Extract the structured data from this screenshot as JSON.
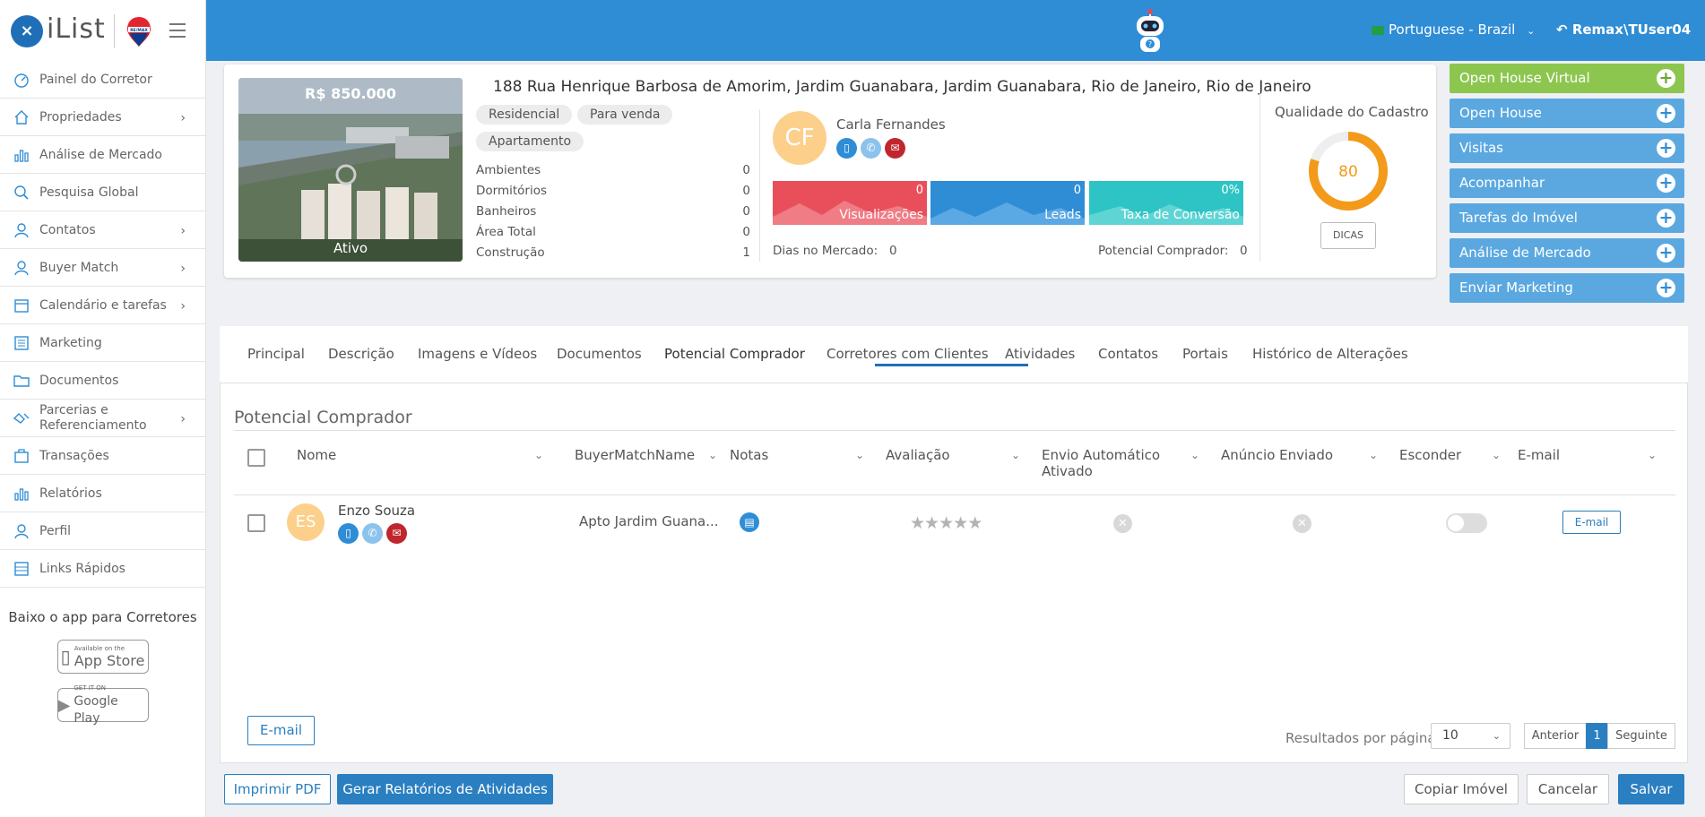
{
  "header": {
    "logo_text": "iList",
    "logo_mark": "×",
    "brand_badge": "RE/MAX",
    "language": "Portuguese - Brazil",
    "user": "Remax\\TUser04"
  },
  "sidebar": {
    "items": [
      {
        "label": "Painel do Corretor",
        "icon": "dashboard-icon"
      },
      {
        "label": "Propriedades",
        "icon": "house-icon"
      },
      {
        "label": "Análise de Mercado",
        "icon": "bar-chart-icon"
      },
      {
        "label": "Pesquisa Global",
        "icon": "search-icon"
      },
      {
        "label": "Contatos",
        "icon": "contacts-icon"
      },
      {
        "label": "Buyer Match",
        "icon": "buyer-match-icon"
      },
      {
        "label": "Calendário e tarefas",
        "icon": "calendar-icon"
      },
      {
        "label": "Marketing",
        "icon": "marketing-icon"
      },
      {
        "label": "Documentos",
        "icon": "folder-icon"
      },
      {
        "label": "Parcerias e Referenciamento",
        "icon": "handshake-icon"
      },
      {
        "label": "Transações",
        "icon": "transactions-icon"
      },
      {
        "label": "Relatórios",
        "icon": "reports-icon"
      },
      {
        "label": "Perfil",
        "icon": "user-icon"
      },
      {
        "label": "Links Rápidos",
        "icon": "quick-links-icon"
      }
    ],
    "app_title": "Baixo o app para Corretores",
    "app_store_small": "Available on the",
    "app_store": "App Store",
    "google_play_small": "GET IT ON",
    "google_play": "Google Play"
  },
  "property": {
    "price": "R$ 850.000",
    "status": "Ativo",
    "address": "188 Rua Henrique Barbosa de Amorim, Jardim Guanabara, Jardim Guanabara, Rio de Janeiro, Rio de Janeiro",
    "tags": [
      "Residencial",
      "Para venda",
      "Apartamento"
    ],
    "specs": [
      {
        "label": "Ambientes",
        "value": "0"
      },
      {
        "label": "Dormitórios",
        "value": "0"
      },
      {
        "label": "Banheiros",
        "value": "0"
      },
      {
        "label": "Área Total",
        "value": "0"
      },
      {
        "label": "Construção",
        "value": "1"
      }
    ],
    "agent_initials": "CF",
    "agent_name": "Carla Fernandes",
    "metrics": [
      {
        "value": "0",
        "label": "Visualizações",
        "color": "#e94f5b"
      },
      {
        "value": "0",
        "label": "Leads",
        "color": "#2f8dd6"
      },
      {
        "value": "0%",
        "label": "Taxa de Conversão",
        "color": "#2ec3c4"
      }
    ],
    "days_label": "Dias no Mercado:",
    "days_value": "0",
    "potential_label": "Potencial Comprador:",
    "potential_value": "0",
    "quality_title": "Qualidade do Cadastro",
    "quality_score": "80",
    "quality_fraction": 0.8,
    "dicas": "DICAS"
  },
  "actions": [
    {
      "label": "Open House Virtual",
      "color": "#8cc64f"
    },
    {
      "label": "Open House",
      "color": "#5ba8e0"
    },
    {
      "label": "Visitas",
      "color": "#5ba8e0"
    },
    {
      "label": "Acompanhar",
      "color": "#5ba8e0"
    },
    {
      "label": "Tarefas do Imóvel",
      "color": "#5ba8e0"
    },
    {
      "label": "Análise de Mercado",
      "color": "#5ba8e0"
    },
    {
      "label": "Enviar Marketing",
      "color": "#5ba8e0"
    }
  ],
  "tabs": [
    "Principal",
    "Descrição",
    "Imagens e Vídeos",
    "Documentos",
    "Potencial Comprador",
    "Corretores com Clientes",
    "Atividades",
    "Contatos",
    "Portais",
    "Histórico de Alterações"
  ],
  "active_tab": "Potencial Comprador",
  "section_title": "Potencial Comprador",
  "table": {
    "columns": [
      "Nome",
      "BuyerMatchName",
      "Notas",
      "Avaliação",
      "Envio Automático Ativado",
      "Anúncio Enviado",
      "Esconder",
      "E-mail"
    ],
    "rows": [
      {
        "initials": "ES",
        "name": "Enzo Souza",
        "buyer_match_name": "Apto Jardim Guana...",
        "rating": 0,
        "rating_max": 5,
        "auto_send": false,
        "ad_sent": false,
        "hidden": false,
        "email_button": "E-mail"
      }
    ]
  },
  "footer_panel": {
    "email_button": "E-mail",
    "per_page_label": "Resultados por página",
    "per_page_value": "10",
    "prev": "Anterior",
    "page": "1",
    "next": "Seguinte"
  },
  "bottom_buttons": {
    "print_pdf": "Imprimir PDF",
    "activity_report": "Gerar Relatórios de Atividades",
    "copy": "Copiar Imóvel",
    "cancel": "Cancelar",
    "save": "Salvar"
  }
}
